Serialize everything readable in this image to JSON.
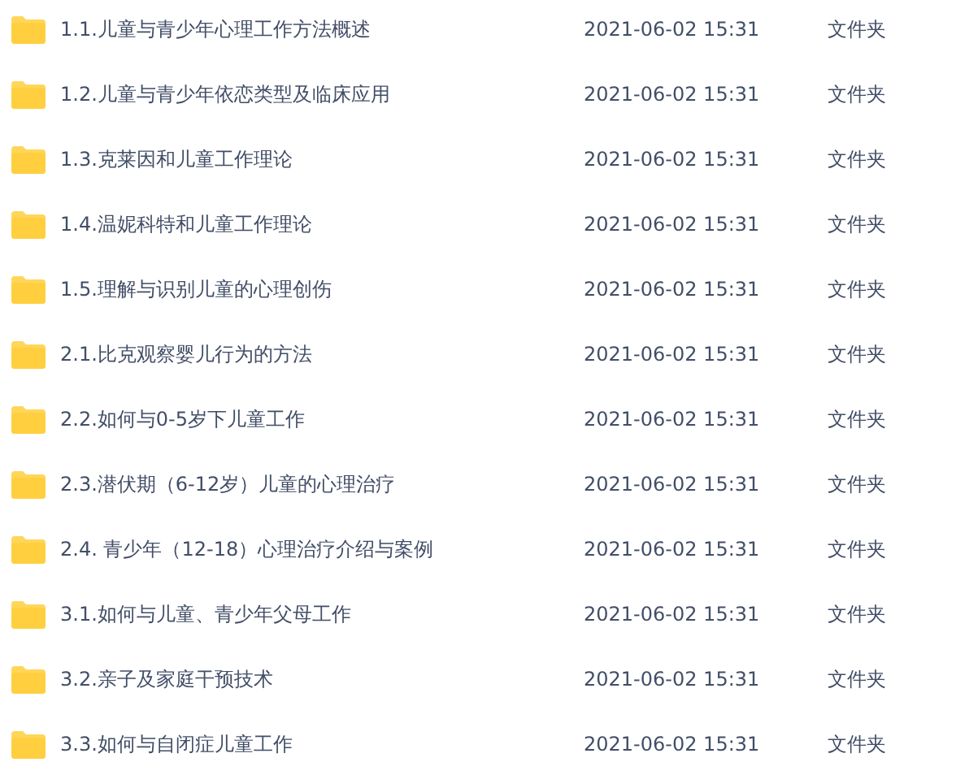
{
  "files": [
    {
      "name": "1.1.儿童与青少年心理工作方法概述",
      "modified": "2021-06-02 15:31",
      "type": "文件夹"
    },
    {
      "name": "1.2.儿童与青少年依恋类型及临床应用",
      "modified": "2021-06-02 15:31",
      "type": "文件夹"
    },
    {
      "name": "1.3.克莱因和儿童工作理论",
      "modified": "2021-06-02 15:31",
      "type": "文件夹"
    },
    {
      "name": "1.4.温妮科特和儿童工作理论",
      "modified": "2021-06-02 15:31",
      "type": "文件夹"
    },
    {
      "name": "1.5.理解与识别儿童的心理创伤",
      "modified": "2021-06-02 15:31",
      "type": "文件夹"
    },
    {
      "name": "2.1.比克观察婴儿行为的方法",
      "modified": "2021-06-02 15:31",
      "type": "文件夹"
    },
    {
      "name": "2.2.如何与0-5岁下儿童工作",
      "modified": "2021-06-02 15:31",
      "type": "文件夹"
    },
    {
      "name": "2.3.潜伏期（6-12岁）儿童的心理治疗",
      "modified": "2021-06-02 15:31",
      "type": "文件夹"
    },
    {
      "name": "2.4. 青少年（12-18）心理治疗介绍与案例",
      "modified": "2021-06-02 15:31",
      "type": "文件夹"
    },
    {
      "name": "3.1.如何与儿童、青少年父母工作",
      "modified": "2021-06-02 15:31",
      "type": "文件夹"
    },
    {
      "name": "3.2.亲子及家庭干预技术",
      "modified": "2021-06-02 15:31",
      "type": "文件夹"
    },
    {
      "name": "3.3.如何与自闭症儿童工作",
      "modified": "2021-06-02 15:31",
      "type": "文件夹"
    }
  ]
}
